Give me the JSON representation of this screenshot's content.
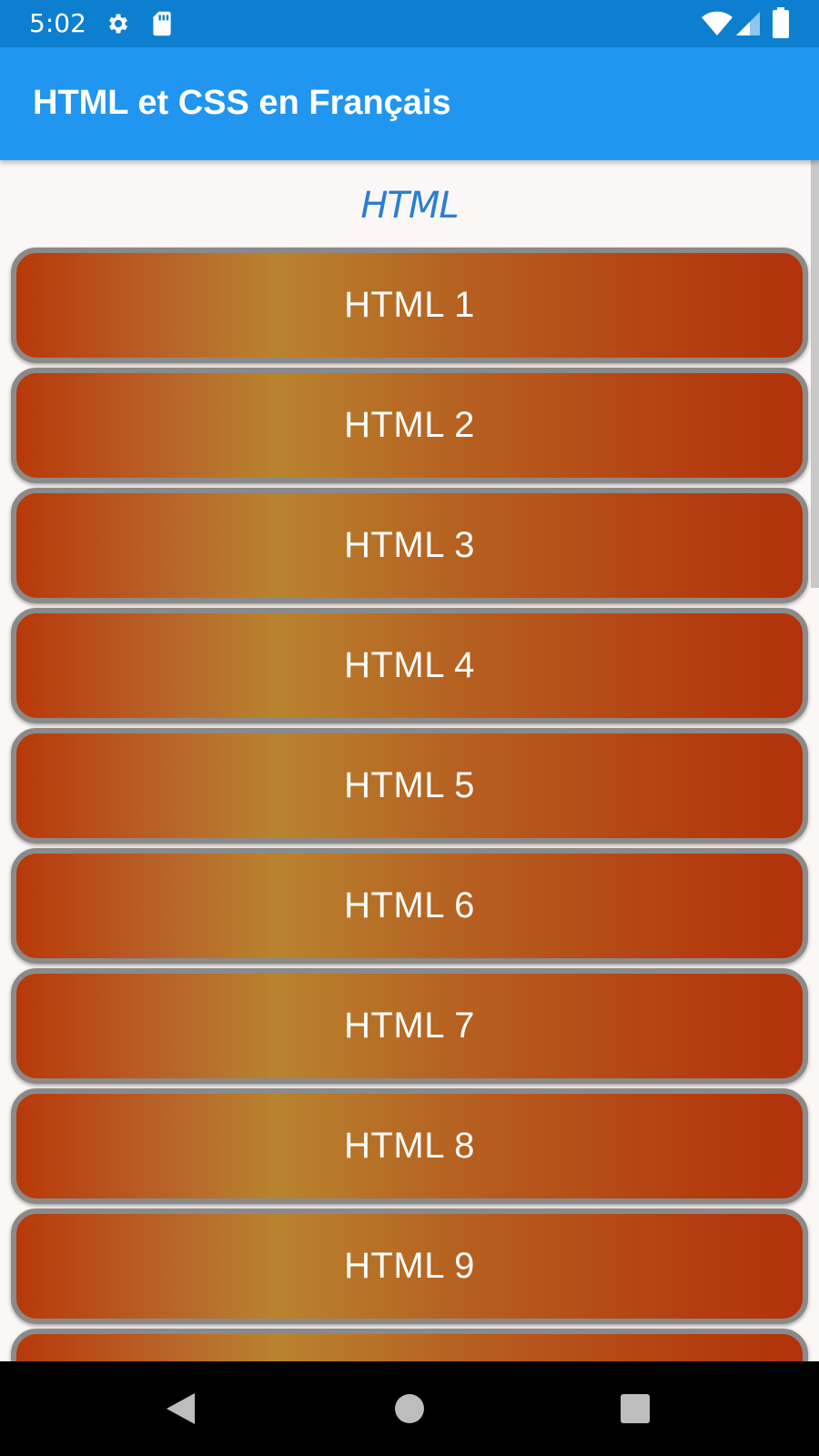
{
  "status_bar": {
    "time": "5:02",
    "icons": [
      "gear-icon",
      "sd-card-icon",
      "wifi-icon",
      "signal-icon",
      "battery-icon"
    ]
  },
  "app_bar": {
    "title": "HTML et CSS en Français",
    "color": "#2196f0"
  },
  "content": {
    "section_title": "HTML",
    "items": [
      {
        "label": "HTML 1"
      },
      {
        "label": "HTML 2"
      },
      {
        "label": "HTML 3"
      },
      {
        "label": "HTML 4"
      },
      {
        "label": "HTML 5"
      },
      {
        "label": "HTML 6"
      },
      {
        "label": "HTML 7"
      },
      {
        "label": "HTML 8"
      },
      {
        "label": "HTML 9"
      },
      {
        "label": ""
      }
    ]
  },
  "nav_bar": {
    "icons": [
      "back-icon",
      "home-icon",
      "recent-apps-icon"
    ]
  },
  "colors": {
    "status_bar": "#0d7fd0",
    "accent_title": "#2a7fd0",
    "item_border": "#8c8a88",
    "item_gradient_dark": "#b8390a",
    "item_gradient_light": "#b8832e"
  }
}
